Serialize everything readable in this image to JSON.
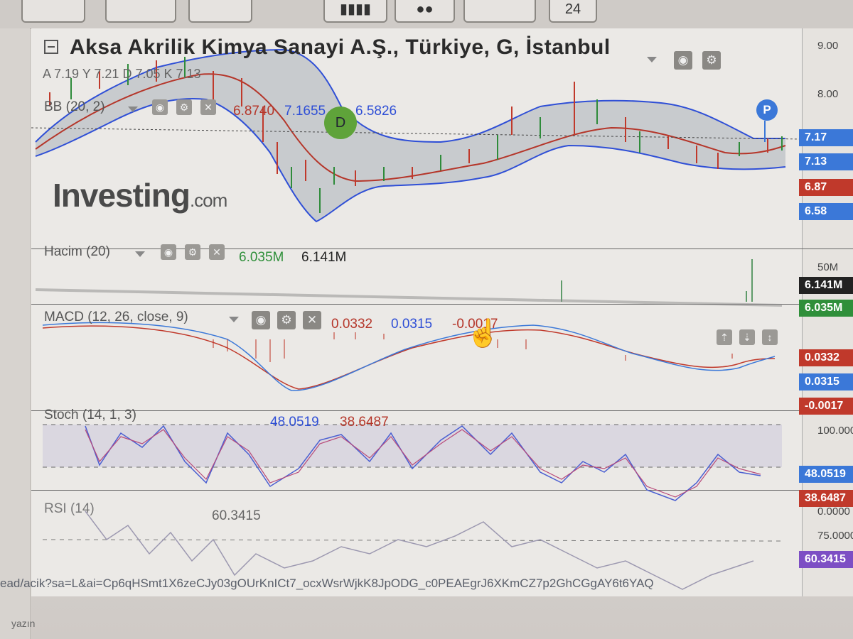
{
  "title": "Aksa Akrilik Kimya Sanayi A.Ş., Türkiye, G, İstanbul",
  "indicators": {
    "ao": "A 7.19  Y 7.21  D 7.05  K 7.13",
    "bb": {
      "label": "BB (20, 2)",
      "v1": "6.8740",
      "v2": "7.1655",
      "v3": "6.5826"
    },
    "volume": {
      "label": "Hacim (20)",
      "v1": "6.035M",
      "v2": "6.141M"
    },
    "macd": {
      "label": "MACD (12, 26, close, 9)",
      "v1": "0.0332",
      "v2": "0.0315",
      "v3": "-0.0017"
    },
    "stoch": {
      "label": "Stoch (14, 1, 3)",
      "v1": "48.0519",
      "v2": "38.6487"
    },
    "rsi": {
      "label": "RSI (14)",
      "v1": "60.3415"
    }
  },
  "markers": {
    "d": "D",
    "p": "P"
  },
  "logo": {
    "main": "Investing",
    "suffix": ".com"
  },
  "axis": {
    "price": [
      "9.00",
      "8.00"
    ],
    "price_tags": [
      {
        "text": "7.17",
        "color": "#3b78d8"
      },
      {
        "text": "7.13",
        "color": "#3b78d8"
      },
      {
        "text": "6.87",
        "color": "#c0392b"
      },
      {
        "text": "6.58",
        "color": "#3b78d8"
      }
    ],
    "volume": "50M",
    "volume_tags": [
      {
        "text": "6.141M",
        "color": "#222222"
      },
      {
        "text": "6.035M",
        "color": "#2f8f3a"
      }
    ],
    "macd_tags": [
      {
        "text": "0.0332",
        "color": "#c0392b"
      },
      {
        "text": "0.0315",
        "color": "#3b78d8"
      },
      {
        "text": "-0.0017",
        "color": "#c0392b"
      }
    ],
    "stoch_top": "100.0000",
    "stoch_tags": [
      {
        "text": "48.0519",
        "color": "#3b78d8"
      },
      {
        "text": "38.6487",
        "color": "#c0392b"
      }
    ],
    "rsi_levels": [
      "0.0000",
      "75.0000"
    ],
    "rsi_tag": {
      "text": "60.3415",
      "color": "#7d4fc4"
    }
  },
  "toolbar_top": "24",
  "url": "ead/acik?sa=L&ai=Cp6qHSmt1X6zeCJy03gOUrKnICt7_ocxWsrWjkK8JpODG_c0PEAEgrJ6XKmCZ7p2GhCGgAY6t6YAQ",
  "bottom": "yazın"
}
